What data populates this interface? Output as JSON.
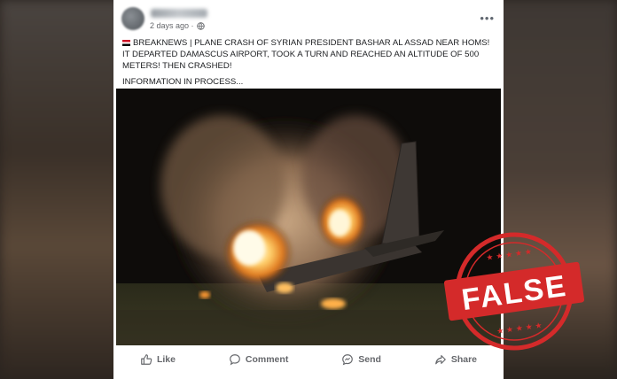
{
  "post": {
    "timestamp": "2 days ago ·",
    "line1": "BREAKNEWS | PLANE CRASH OF  SYRIAN PRESIDENT BASHAR AL ASSAD NEAR HOMS! IT DEPARTED DAMASCUS AIRPORT, TOOK A TURN AND REACHED AN ALTITUDE OF 500 METERS! THEN CRASHED!",
    "line2": "INFORMATION IN PROCESS..."
  },
  "actions": {
    "like": "Like",
    "comment": "Comment",
    "send": "Send",
    "share": "Share"
  },
  "stamp": {
    "label": "FALSE",
    "color": "#d42a2a"
  },
  "colors": {
    "card_bg": "#ffffff",
    "text": "#1c1e21",
    "muted": "#65676b"
  },
  "icons": [
    "globe-icon",
    "more-icon",
    "like-icon",
    "comment-icon",
    "send-icon",
    "share-icon",
    "syria-flag-icon"
  ]
}
